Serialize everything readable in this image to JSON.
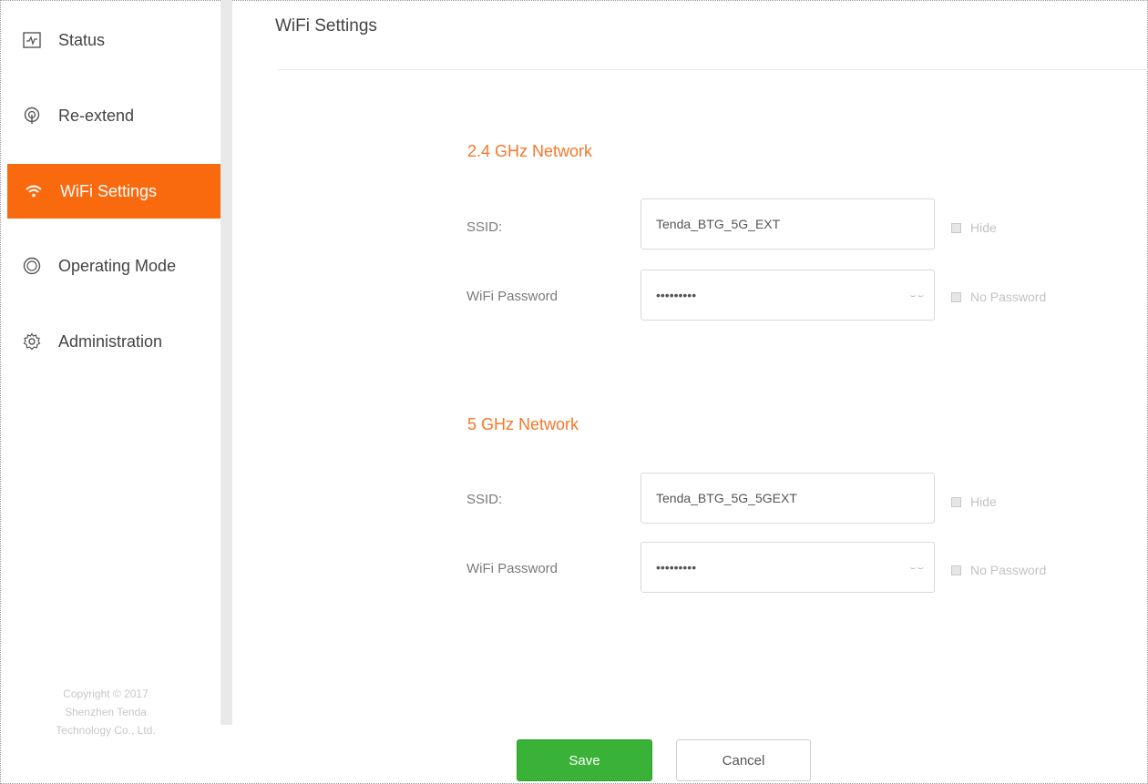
{
  "sidebar": {
    "items": [
      {
        "label": "Status",
        "icon": "status-icon"
      },
      {
        "label": "Re-extend",
        "icon": "re-extend-icon"
      },
      {
        "label": "WiFi Settings",
        "icon": "wifi-icon",
        "active": true
      },
      {
        "label": "Operating Mode",
        "icon": "operating-mode-icon"
      },
      {
        "label": "Administration",
        "icon": "gear-icon"
      }
    ],
    "copyright": [
      "Copyright © 2017",
      "Shenzhen Tenda",
      "Technology Co., Ltd."
    ]
  },
  "page": {
    "title": "WiFi Settings"
  },
  "network_24": {
    "title": "2.4 GHz Network",
    "ssid_label": "SSID:",
    "ssid_value": "Tenda_BTG_5G_EXT",
    "hide_label": "Hide",
    "password_label": "WiFi Password",
    "password_value": "•••••••••",
    "no_password_label": "No Password"
  },
  "network_5": {
    "title": "5 GHz Network",
    "ssid_label": "SSID:",
    "ssid_value": "Tenda_BTG_5G_5GEXT",
    "hide_label": "Hide",
    "password_label": "WiFi Password",
    "password_value": "•••••••••",
    "no_password_label": "No Password"
  },
  "buttons": {
    "save": "Save",
    "cancel": "Cancel"
  },
  "colors": {
    "accent": "#f96a0f",
    "section_title": "#f5772a",
    "save_button": "#3ab137"
  }
}
